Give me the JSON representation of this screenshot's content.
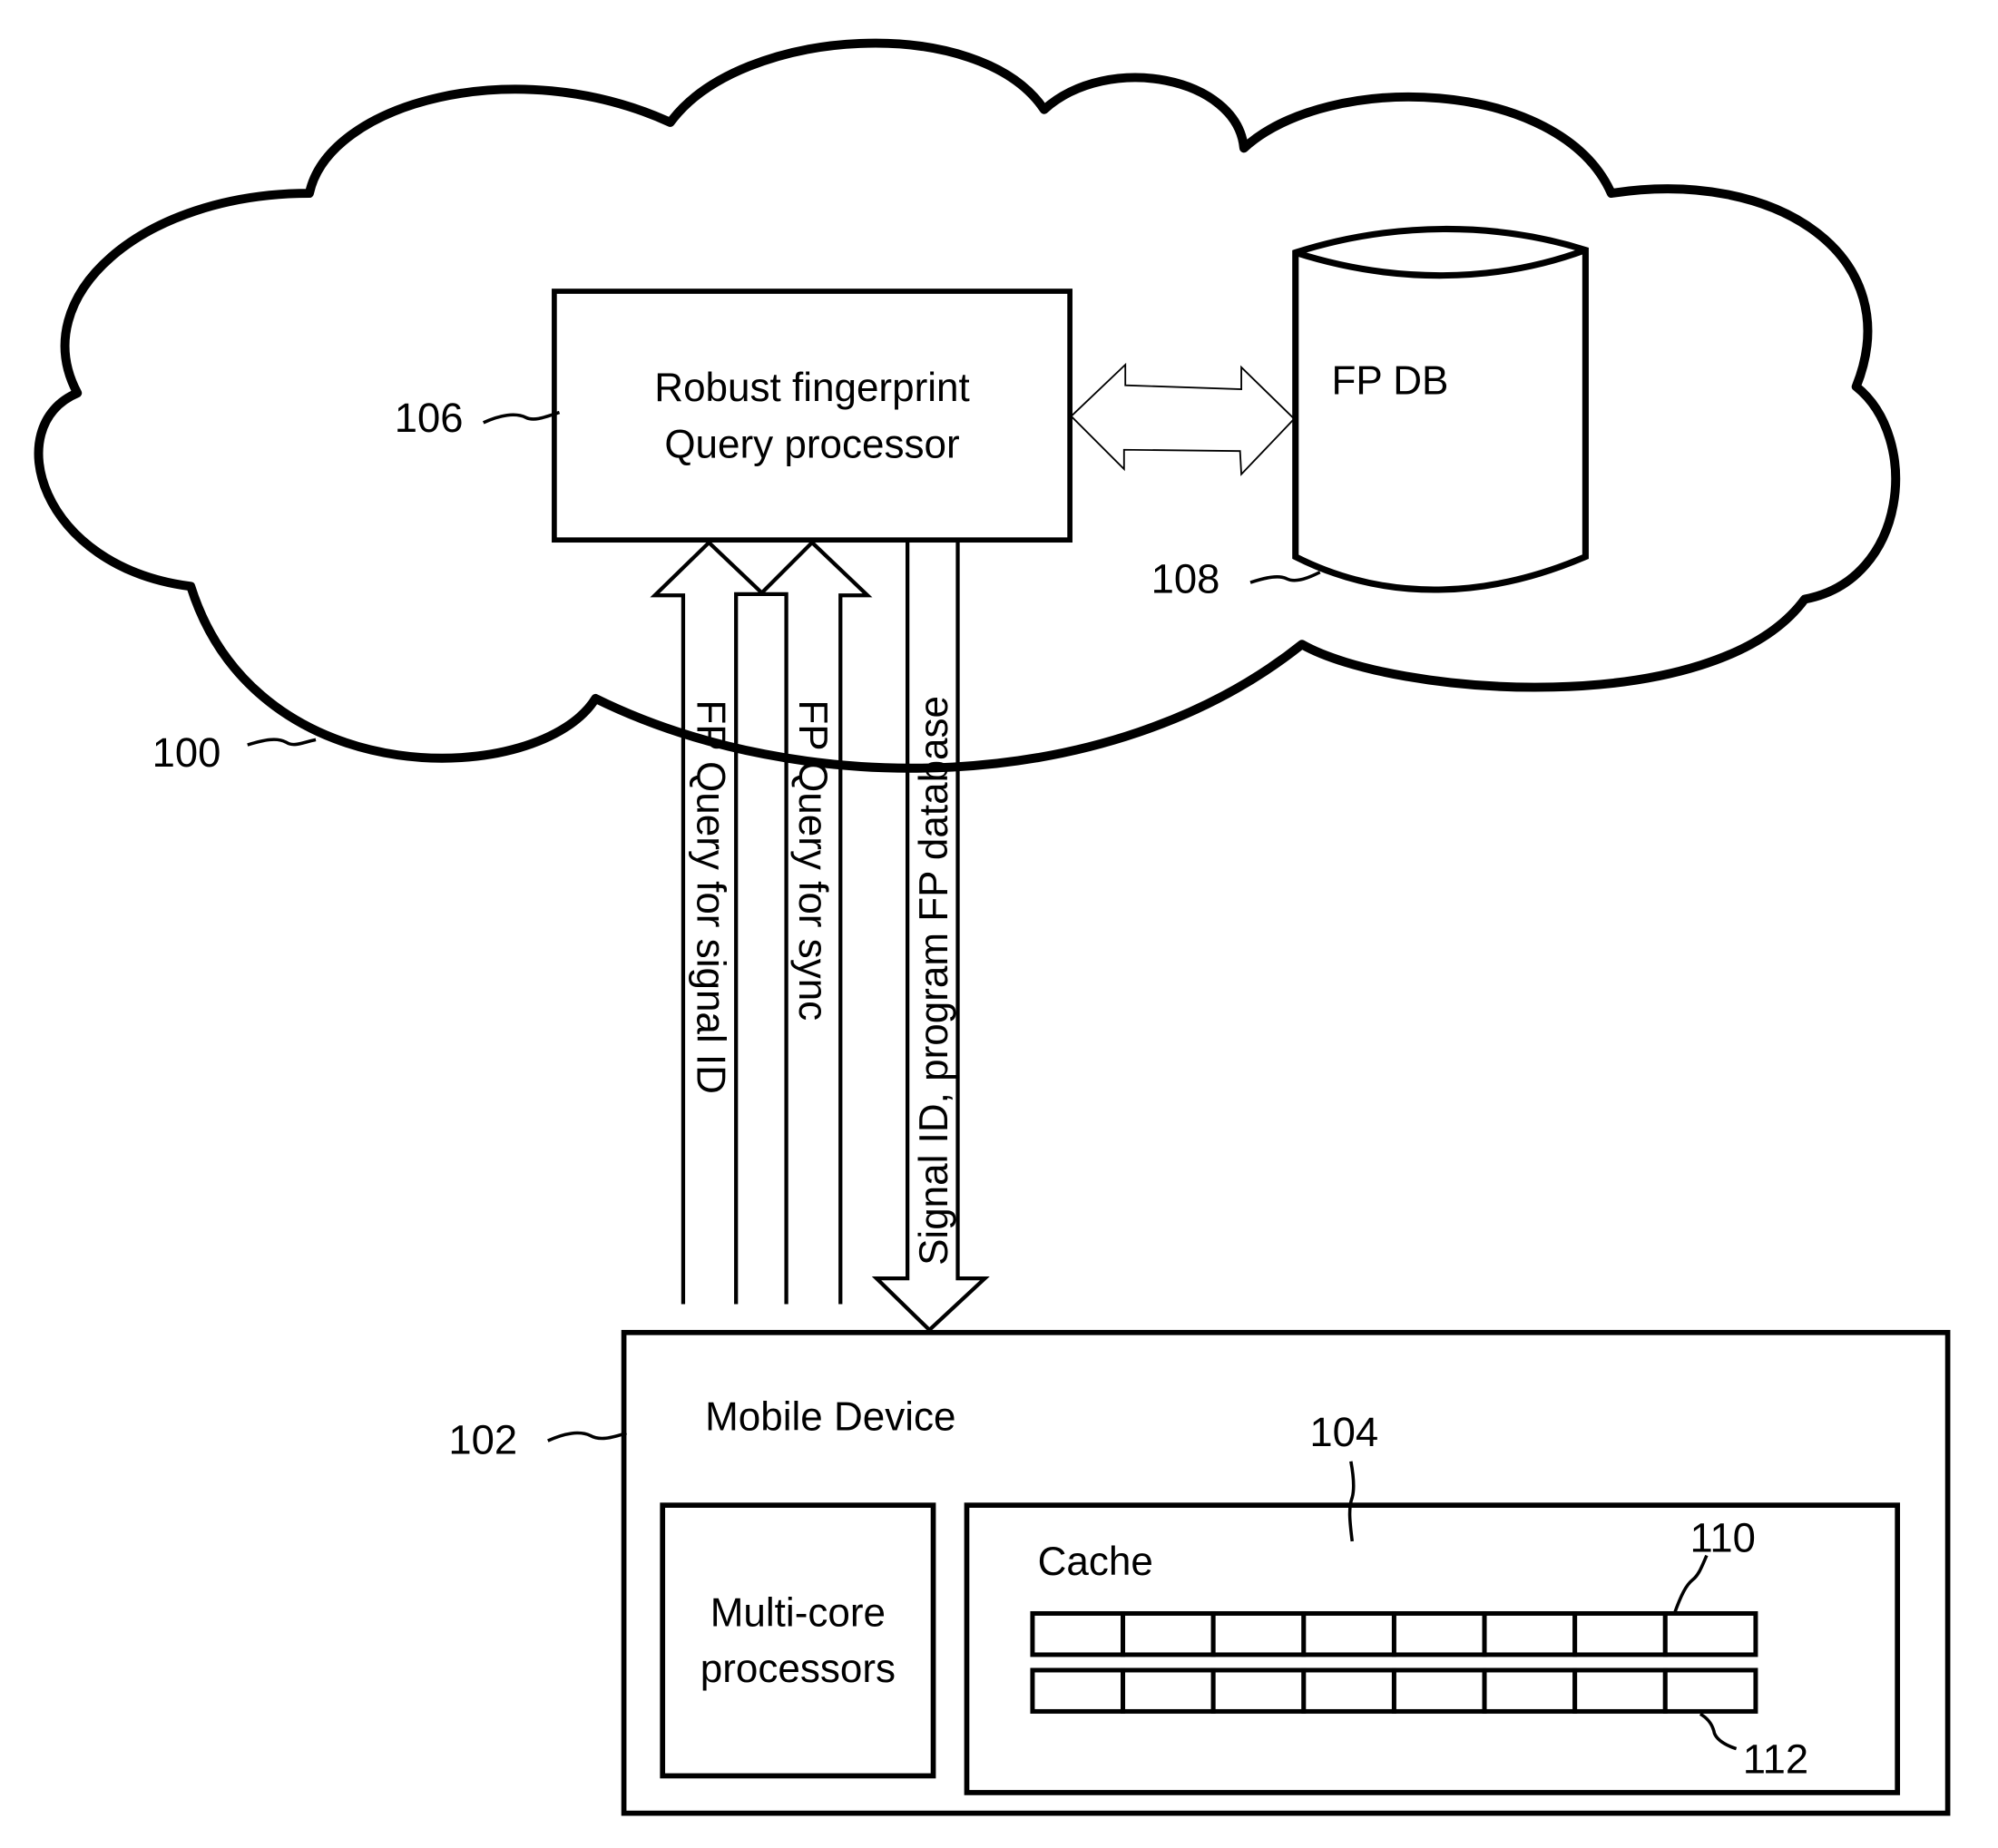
{
  "figure": {
    "cloud": {
      "ref": "100"
    },
    "query_processor": {
      "ref": "106",
      "line1": "Robust fingerprint",
      "line2": "Query processor"
    },
    "database": {
      "ref": "108",
      "label": "FP DB"
    },
    "arrows": {
      "up_signal_id": "FP Query for signal ID",
      "up_sync": "FP Query for sync",
      "down_result": "Signal ID, program FP database"
    },
    "mobile_device": {
      "ref": "102",
      "label": "Mobile Device",
      "processors": {
        "line1": "Multi-core",
        "line2": "processors"
      },
      "cache": {
        "ref": "104",
        "label": "Cache",
        "row_top_ref": "110",
        "row_bottom_ref": "112",
        "cells_per_row": 8
      }
    }
  },
  "colors": {
    "ink": "#000000",
    "background": "#ffffff"
  }
}
